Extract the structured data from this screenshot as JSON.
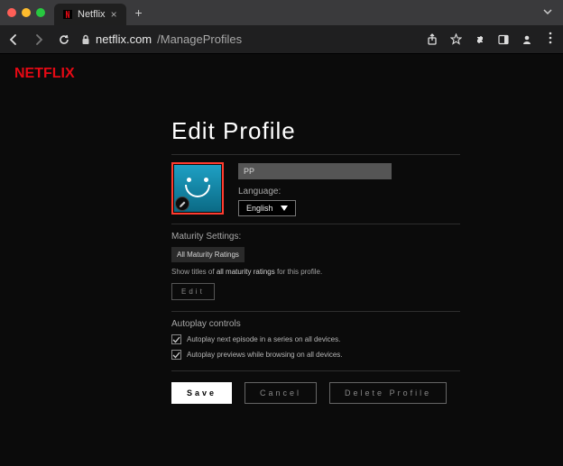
{
  "browser": {
    "tab_title": "Netflix",
    "url_host": "netflix.com",
    "url_path": "/ManageProfiles"
  },
  "logo_text": "NETFLIX",
  "page_title": "Edit Profile",
  "profile": {
    "name_value": "PP",
    "language_label": "Language:",
    "language_selected": "English"
  },
  "maturity": {
    "section_label": "Maturity Settings:",
    "rating_label": "All Maturity Ratings",
    "subtext_prefix": "Show titles of ",
    "subtext_strong": "all maturity ratings",
    "subtext_suffix": " for this profile.",
    "edit_button": "Edit"
  },
  "autoplay": {
    "section_label": "Autoplay controls",
    "option1": "Autoplay next episode in a series on all devices.",
    "option2": "Autoplay previews while browsing on all devices."
  },
  "buttons": {
    "save": "Save",
    "cancel": "Cancel",
    "delete": "Delete Profile"
  }
}
